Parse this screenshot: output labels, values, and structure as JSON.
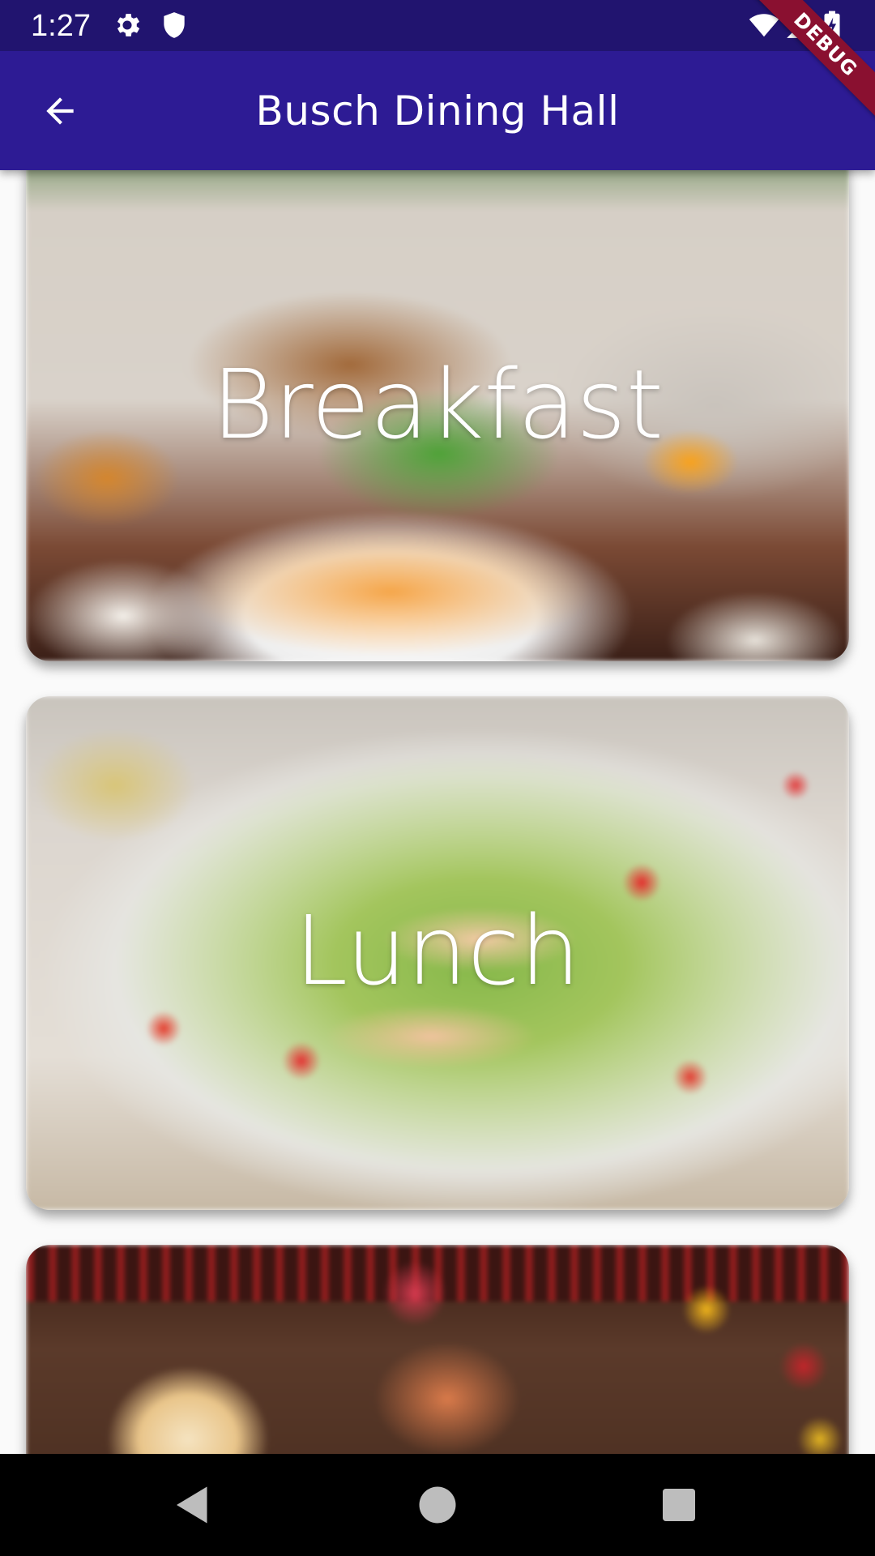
{
  "status_bar": {
    "time": "1:27",
    "left_icons": [
      "gear-icon",
      "shield-icon"
    ],
    "right_icons": [
      "wifi-icon",
      "cell-signal-icon",
      "battery-charging-icon"
    ]
  },
  "app_bar": {
    "title": "Busch Dining Hall",
    "back_icon": "arrow-back-icon",
    "background_color": "#2d1b94"
  },
  "debug_banner": {
    "label": "DEBUG",
    "color": "#8a1030"
  },
  "meals": [
    {
      "label": "Breakfast"
    },
    {
      "label": "Lunch"
    },
    {
      "label": ""
    }
  ],
  "nav_bar": {
    "buttons": [
      "back-triangle-icon",
      "home-circle-icon",
      "recents-square-icon"
    ]
  }
}
